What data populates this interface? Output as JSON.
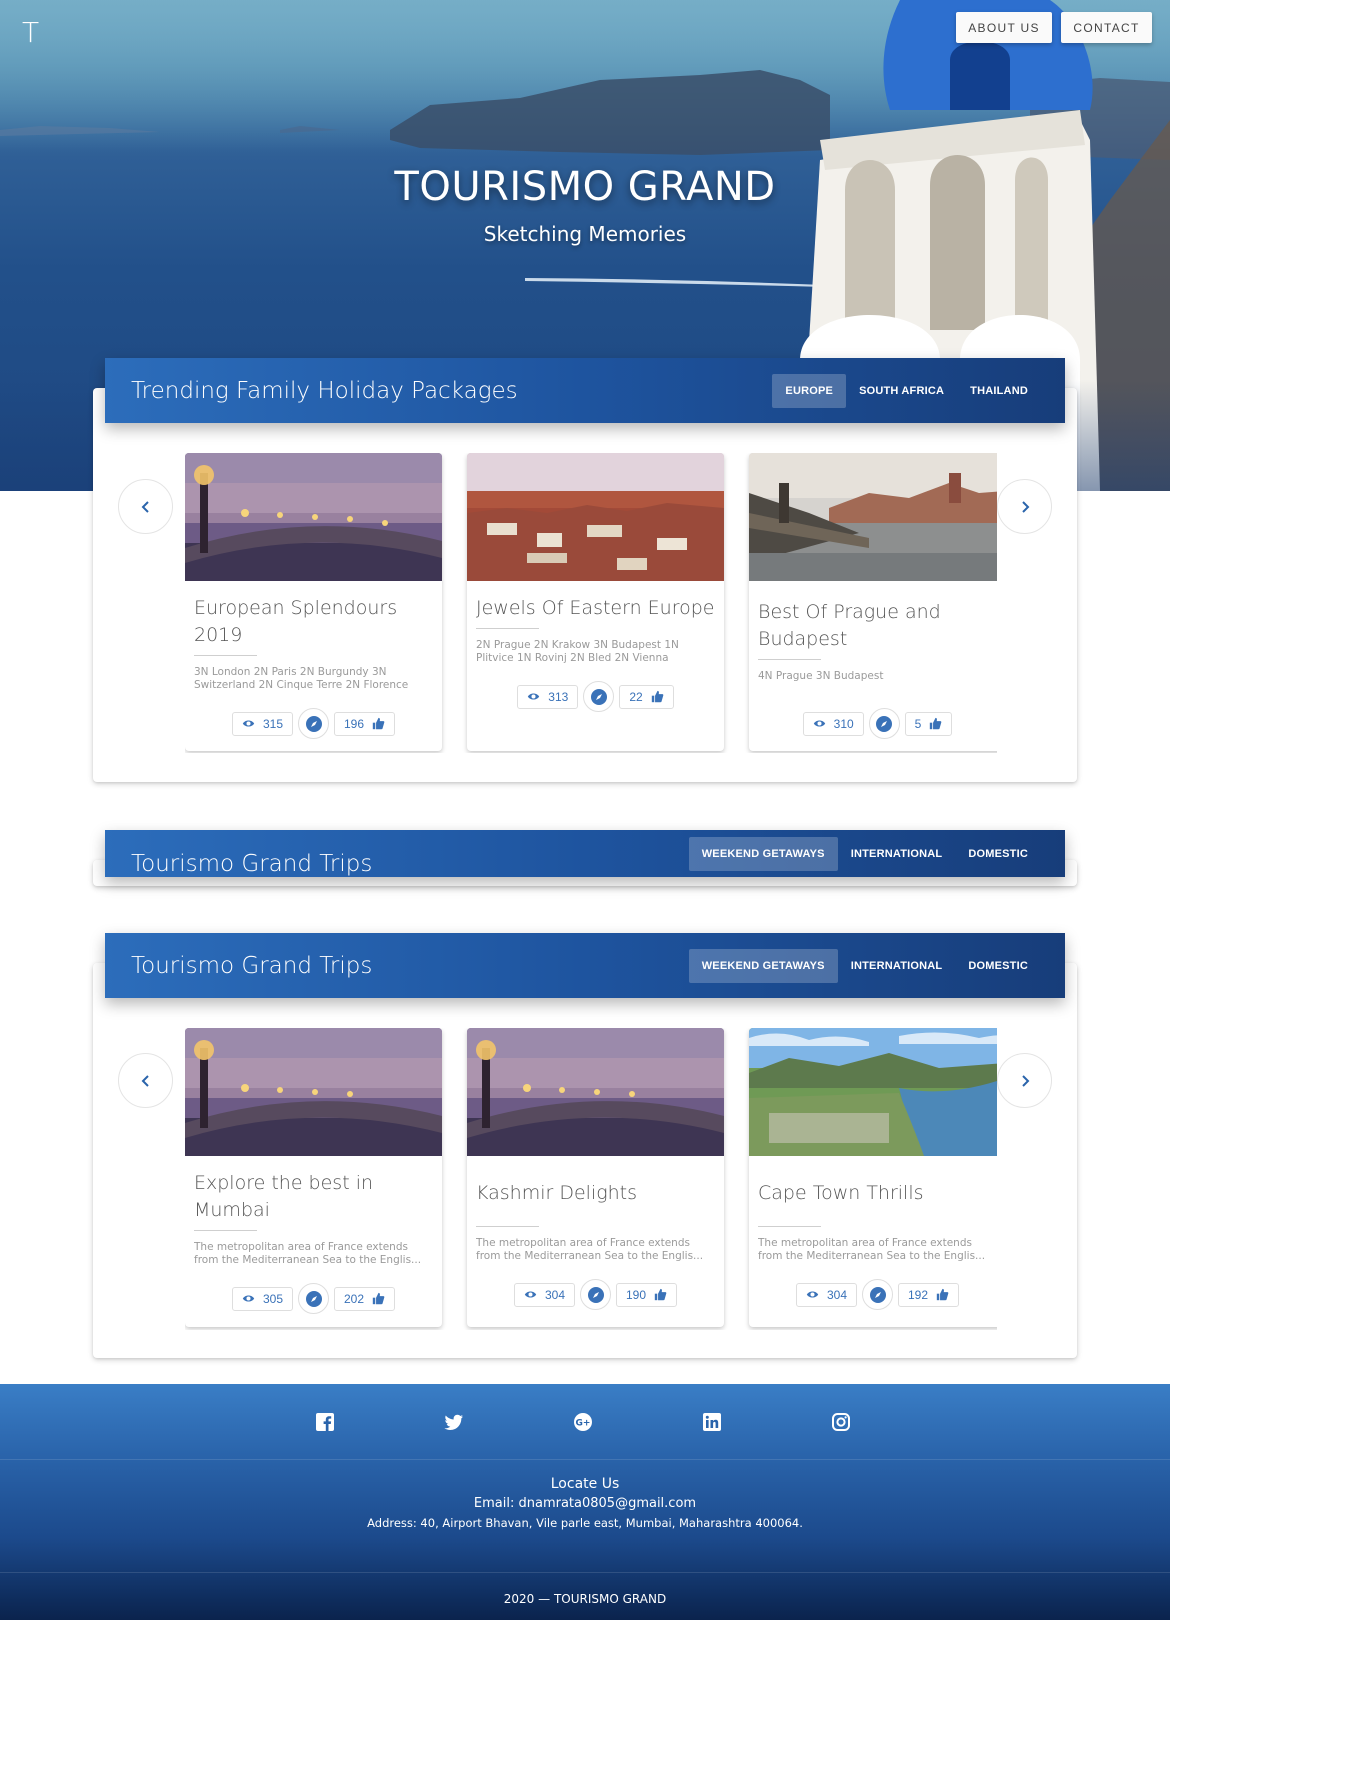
{
  "brand": {
    "logo": "T",
    "title": "TOURISMO GRAND",
    "tagline": "Sketching Memories"
  },
  "nav": {
    "about": "ABOUT US",
    "contact": "CONTACT"
  },
  "sections": [
    {
      "title": "Trending Family Holiday Packages",
      "tabs": [
        "EUROPE",
        "SOUTH AFRICA",
        "THAILAND"
      ],
      "active_tab": "EUROPE",
      "cards": [
        {
          "title": "European Splendours 2019",
          "desc": "3N London 2N Paris 2N Burgundy 3N Switzerland 2N Cinque Terre 2N Florence",
          "views": "315",
          "likes": "196"
        },
        {
          "title": "Jewels Of Eastern Europe",
          "desc": "2N Prague 2N Krakow 3N Budapest 1N Plitvice 1N Rovinj 2N Bled 2N Vienna",
          "views": "313",
          "likes": "22"
        },
        {
          "title": "Best Of Prague and Budapest",
          "desc": "4N Prague 3N Budapest",
          "views": "310",
          "likes": "5"
        }
      ]
    },
    {
      "title": "Tourismo Grand Trips",
      "tabs": [
        "WEEKEND GETAWAYS",
        "INTERNATIONAL",
        "DOMESTIC"
      ],
      "active_tab": "WEEKEND GETAWAYS",
      "cards": []
    },
    {
      "title": "Tourismo Grand Trips",
      "tabs": [
        "WEEKEND GETAWAYS",
        "INTERNATIONAL",
        "DOMESTIC"
      ],
      "active_tab": "WEEKEND GETAWAYS",
      "cards": [
        {
          "title": "Explore the best in Mumbai",
          "desc": "The metropolitan area of France extends from the Mediterranean Sea to the Englis...",
          "views": "305",
          "likes": "202"
        },
        {
          "title": "Kashmir Delights",
          "desc": "The metropolitan area of France extends from the Mediterranean Sea to the Englis...",
          "views": "304",
          "likes": "190"
        },
        {
          "title": "Cape Town Thrills",
          "desc": "The metropolitan area of France extends from the Mediterranean Sea to the Englis...",
          "views": "304",
          "likes": "192"
        }
      ]
    }
  ],
  "footer": {
    "social": [
      "facebook-icon",
      "twitter-icon",
      "google-plus-icon",
      "linkedin-icon",
      "instagram-icon"
    ],
    "locate_heading": "Locate Us",
    "email": "Email: dnamrata0805@gmail.com",
    "address": "Address: 40, Airport Bhavan, Vile parle east, Mumbai, Maharashtra 400064.",
    "copyright": "2020 — TOURISMO GRAND"
  },
  "colors": {
    "accent": "#2a64ab",
    "header_dark": "#173d7a",
    "pill_text": "#3a72b8"
  }
}
